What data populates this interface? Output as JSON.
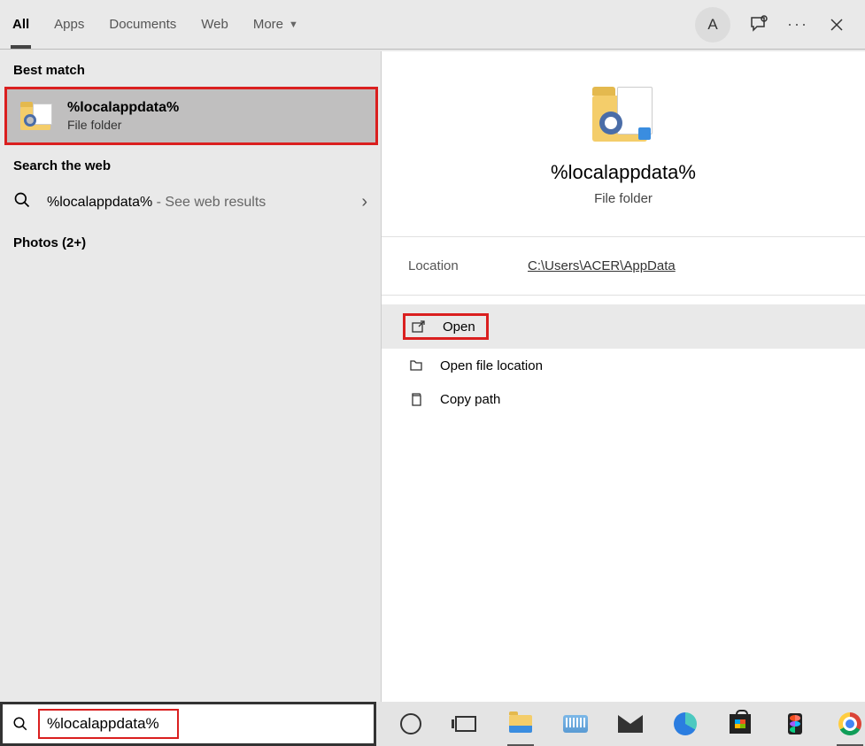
{
  "tabs": {
    "all": "All",
    "apps": "Apps",
    "documents": "Documents",
    "web": "Web",
    "more": "More"
  },
  "avatar_initial": "A",
  "sections": {
    "best_match": "Best match",
    "search_web": "Search the web",
    "photos": "Photos (2+)"
  },
  "best_match": {
    "title": "%localappdata%",
    "subtitle": "File folder"
  },
  "web_result": {
    "query": "%localappdata%",
    "suffix": " - See web results"
  },
  "preview": {
    "title": "%localappdata%",
    "subtitle": "File folder",
    "location_label": "Location",
    "location_value": "C:\\Users\\ACER\\AppData"
  },
  "actions": {
    "open": "Open",
    "open_location": "Open file location",
    "copy_path": "Copy path"
  },
  "search_input_value": "%localappdata%"
}
